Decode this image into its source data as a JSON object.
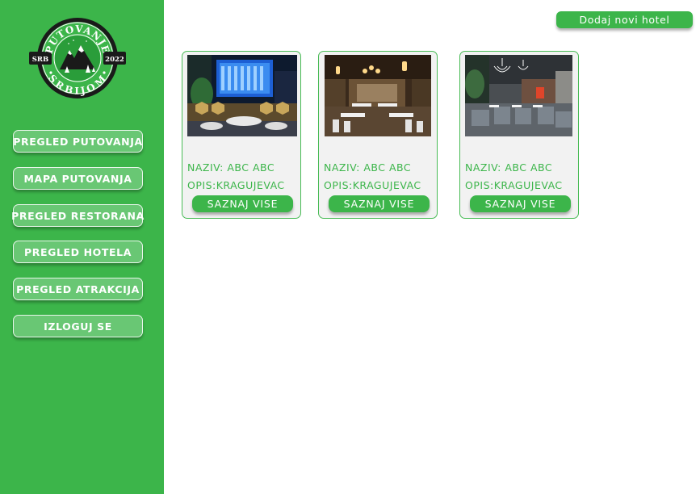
{
  "logo": {
    "top_text": "PUTOVANJE",
    "bottom_text": "SRBIJOM",
    "left_badge": "SRB",
    "right_badge": "2022"
  },
  "sidebar": {
    "items": [
      {
        "label": "PREGLED PUTOVANJA"
      },
      {
        "label": "MAPA PUTOVANJA"
      },
      {
        "label": "PREGLED RESTORANA"
      },
      {
        "label": "PREGLED HOTELA"
      },
      {
        "label": "PREGLED ATRAKCIJA"
      },
      {
        "label": "IZLOGUJ SE"
      }
    ]
  },
  "header": {
    "add_button_label": "Dodaj novi hotel"
  },
  "cards": [
    {
      "name": "NAZIV: ABC ABC",
      "description": "OPIS:KRAGUJEVAC",
      "button_label": "SAZNAJ VISE"
    },
    {
      "name": "NAZIV: ABC ABC",
      "description": "OPIS:KRAGUJEVAC",
      "button_label": "SAZNAJ VISE"
    },
    {
      "name": "NAZIV: ABC ABC",
      "description": "OPIS:KRAGUJEVAC",
      "button_label": "SAZNAJ VISE"
    }
  ],
  "colors": {
    "brand_green": "#3cb54a",
    "nav_button": "#69c774",
    "card_background": "#f2f2f2",
    "logo_dark": "#1a1a1a"
  }
}
